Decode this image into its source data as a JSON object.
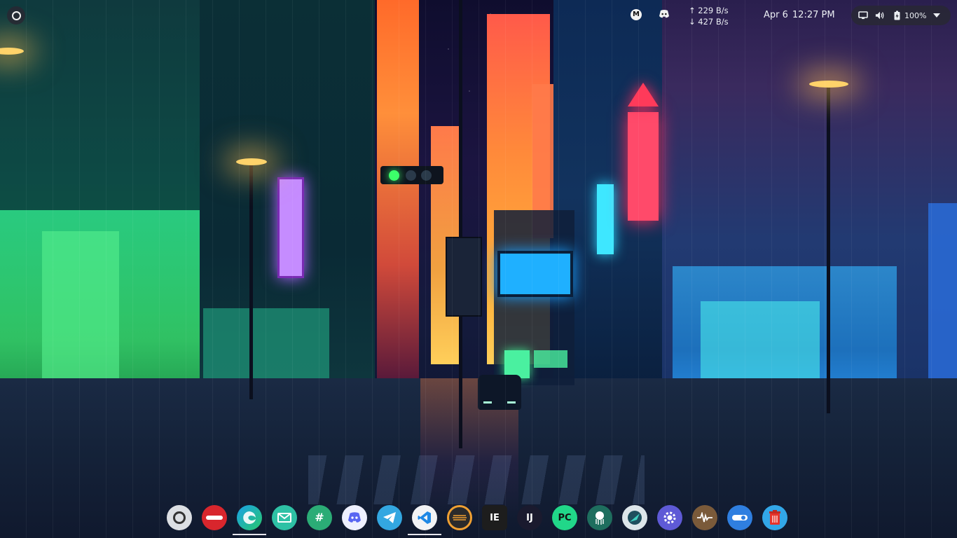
{
  "topbar": {
    "activities_icon": "circle-activities-icon",
    "tray": {
      "m_icon": "M",
      "discord_icon": "discord-icon"
    },
    "netspeed": {
      "up": "↑ 229 B/s",
      "down": "↓ 427 B/s"
    },
    "clock": {
      "date": "Apr 6",
      "time": "12:27 PM"
    },
    "system": {
      "screen_icon": "screen-icon",
      "volume_icon": "volume-icon",
      "battery_icon": "battery-charging-icon",
      "battery_percent": "100%",
      "menu_icon": "chevron-down-icon"
    }
  },
  "dock": {
    "items": [
      {
        "name": "ubuntu-launcher-icon"
      },
      {
        "name": "red-app-icon"
      },
      {
        "name": "microsoft-edge-icon",
        "running": true
      },
      {
        "name": "mail-icon"
      },
      {
        "name": "slack-icon"
      },
      {
        "name": "discord-icon"
      },
      {
        "name": "telegram-icon"
      },
      {
        "name": "vscode-icon",
        "running": true
      },
      {
        "name": "ring-app-icon"
      },
      {
        "name": "ie-app-icon",
        "label": "IE"
      },
      {
        "name": "intellij-icon",
        "label": "IJ"
      },
      {
        "name": "pycharm-icon",
        "label": "PC"
      },
      {
        "name": "gitkraken-icon"
      },
      {
        "name": "globe-app-icon"
      },
      {
        "name": "settings-gear-icon"
      },
      {
        "name": "waveform-app-icon"
      },
      {
        "name": "toggle-app-icon"
      },
      {
        "name": "trash-icon"
      }
    ]
  },
  "colors": {
    "panel_bg": "#282834",
    "text": "#eceff4",
    "accent_green": "#3cff6a"
  }
}
